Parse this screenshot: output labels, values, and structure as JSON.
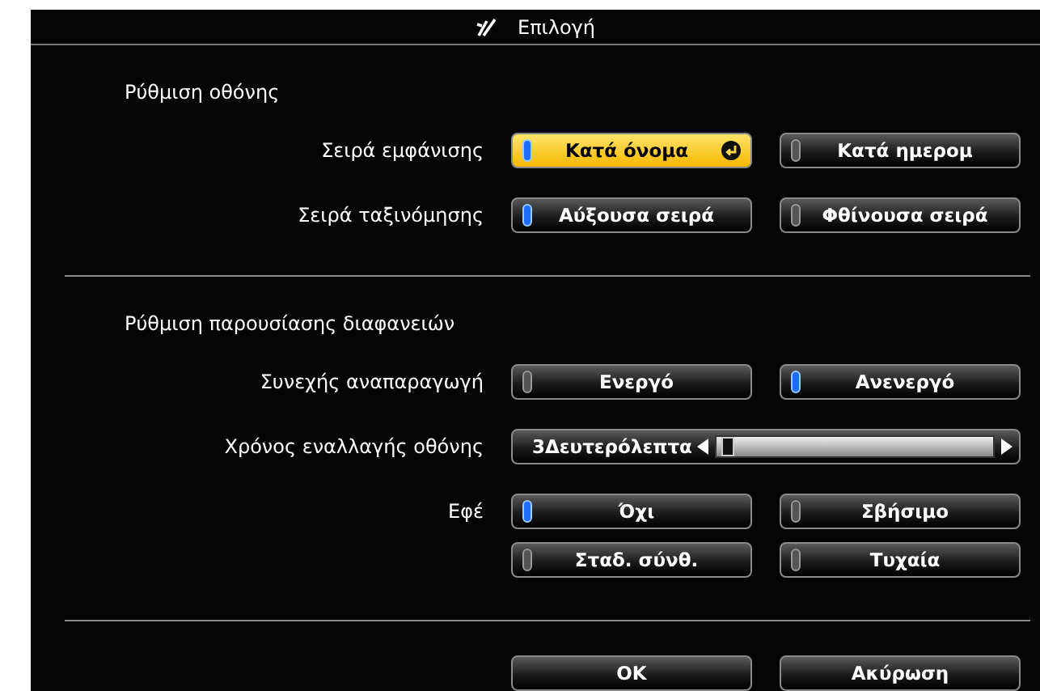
{
  "title": "Επιλογή",
  "sections": [
    {
      "heading": "Ρύθμιση οθόνης",
      "rows": [
        {
          "kind": "options",
          "label": "Σειρά εμφάνισης",
          "options": [
            {
              "label": "Κατά όνομα",
              "selected": true,
              "focused": true
            },
            {
              "label": "Κατά ημερομ",
              "selected": false,
              "focused": false
            }
          ]
        },
        {
          "kind": "options",
          "label": "Σειρά ταξινόμησης",
          "options": [
            {
              "label": "Αύξουσα σειρά",
              "selected": true,
              "focused": false
            },
            {
              "label": "Φθίνουσα σειρά",
              "selected": false,
              "focused": false
            }
          ]
        }
      ]
    },
    {
      "heading": "Ρύθμιση παρουσίασης διαφανειών",
      "rows": [
        {
          "kind": "options",
          "label": "Συνεχής αναπαραγωγή",
          "options": [
            {
              "label": "Ενεργό",
              "selected": false,
              "focused": false
            },
            {
              "label": "Ανενεργό",
              "selected": true,
              "focused": false
            }
          ]
        },
        {
          "kind": "slider",
          "label": "Χρόνος εναλλαγής οθόνης",
          "value": "3Δευτερόλεπτα",
          "level": 0.02
        },
        {
          "kind": "options",
          "label": "Εφέ",
          "options": [
            {
              "label": "Όχι",
              "selected": true,
              "focused": false
            },
            {
              "label": "Σβήσιμο",
              "selected": false,
              "focused": false
            },
            {
              "label": "Σταδ. σύνθ.",
              "selected": false,
              "focused": false
            },
            {
              "label": "Τυχαία",
              "selected": false,
              "focused": false
            }
          ]
        }
      ]
    }
  ],
  "buttons": [
    "OK",
    "Ακύρωση"
  ]
}
